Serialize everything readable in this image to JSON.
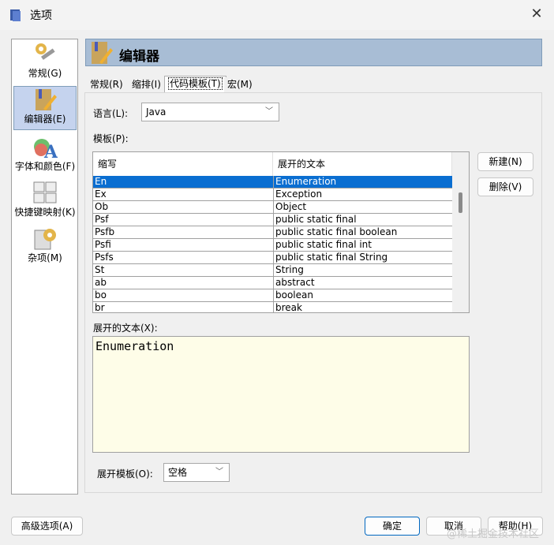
{
  "window": {
    "title": "选项",
    "close": "✕"
  },
  "sidebar": {
    "items": [
      {
        "label": "常规(G)",
        "icon": "general-settings-icon"
      },
      {
        "label": "编辑器(E)",
        "icon": "editor-icon",
        "selected": true
      },
      {
        "label": "字体和颜色(F)",
        "icon": "fonts-colors-icon"
      },
      {
        "label": "快捷键映射(K)",
        "icon": "keymap-icon"
      },
      {
        "label": "杂项(M)",
        "icon": "misc-icon"
      }
    ]
  },
  "header": {
    "title": "编辑器"
  },
  "tabs": [
    {
      "label": "常规(R)"
    },
    {
      "label": "缩排(I)"
    },
    {
      "label": "代码模板(T)",
      "selected": true
    },
    {
      "label": "宏(M)"
    }
  ],
  "language": {
    "label": "语言(L):",
    "value": "Java"
  },
  "templates": {
    "label": "模板(P):",
    "columns": [
      "缩写",
      "展开的文本"
    ],
    "rows": [
      [
        "En",
        "Enumeration"
      ],
      [
        "Ex",
        "Exception"
      ],
      [
        "Ob",
        "Object"
      ],
      [
        "Psf",
        "public static final"
      ],
      [
        "Psfb",
        "public static final boolean"
      ],
      [
        "Psfi",
        "public static final int"
      ],
      [
        "Psfs",
        "public static final String"
      ],
      [
        "St",
        "String"
      ],
      [
        "ab",
        "abstract"
      ],
      [
        "bo",
        "boolean"
      ],
      [
        "br",
        "break"
      ]
    ],
    "selected_index": 0,
    "new_button": "新建(N)",
    "delete_button": "删除(V)"
  },
  "expanded": {
    "label": "展开的文本(X):",
    "value": "Enumeration"
  },
  "expand_with": {
    "label": "展开模板(O):",
    "value": "空格"
  },
  "footer": {
    "advanced": "高级选项(A)",
    "ok": "确定",
    "cancel": "取消",
    "help": "帮助(H)"
  },
  "watermark": "@稀土掘金技术社区"
}
